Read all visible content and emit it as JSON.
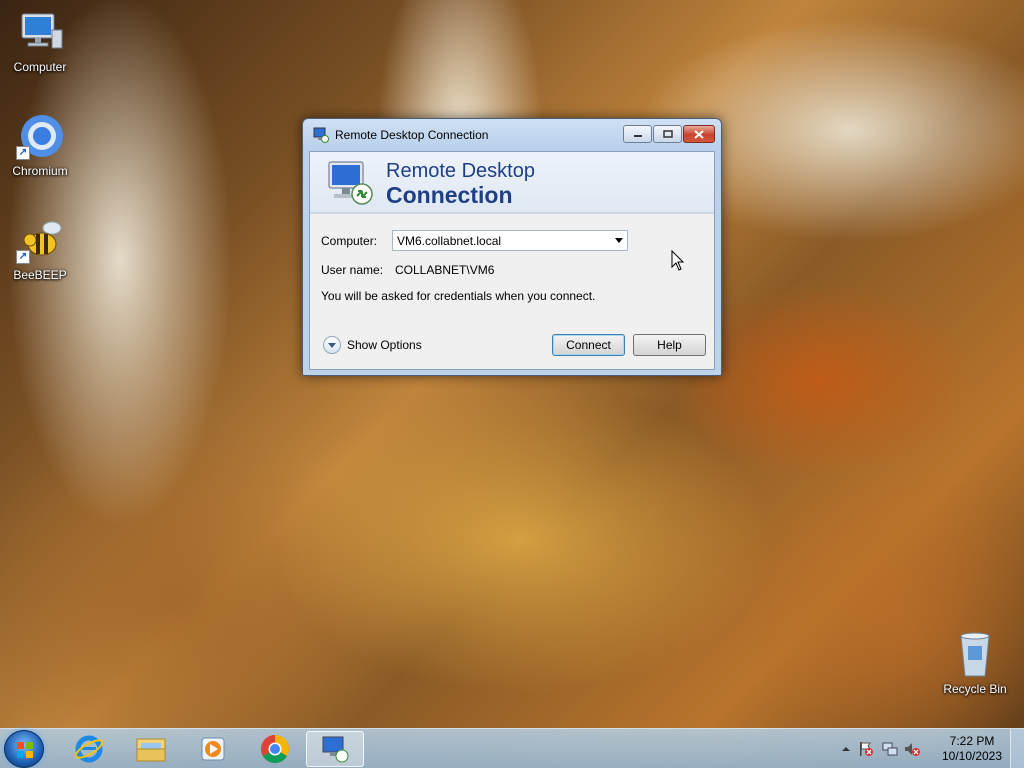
{
  "desktop": {
    "icons": [
      {
        "label": "Computer"
      },
      {
        "label": "Chromium"
      },
      {
        "label": "BeeBEEP"
      },
      {
        "label": "Recycle Bin"
      }
    ]
  },
  "window": {
    "title": "Remote Desktop Connection",
    "banner_line1": "Remote Desktop",
    "banner_line2": "Connection",
    "computer_label": "Computer:",
    "computer_value": "VM6.collabnet.local",
    "username_label": "User name:",
    "username_value": "COLLABNET\\VM6",
    "info_text": "You will be asked for credentials when you connect.",
    "show_options_label": "Show Options",
    "connect_label": "Connect",
    "help_label": "Help"
  },
  "taskbar": {
    "items": [
      "start",
      "internet-explorer",
      "windows-explorer",
      "media-player",
      "chrome",
      "remote-desktop"
    ],
    "time": "7:22 PM",
    "date": "10/10/2023"
  },
  "colors": {
    "banner_text": "#1e3f86",
    "close_button": "#c8442c"
  }
}
